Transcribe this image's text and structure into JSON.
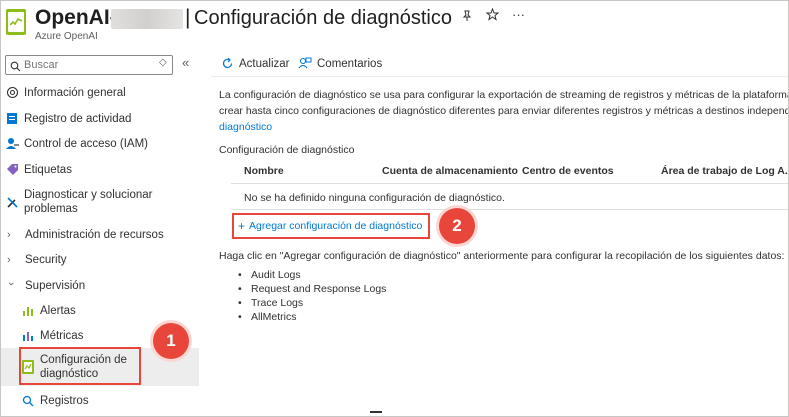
{
  "header": {
    "resource_name": "OpenAI-",
    "separator": "|",
    "page_title": "Configuración de diagnóstico",
    "subtitle": "Azure OpenAI",
    "pin_icon": "pin-icon",
    "favorite_icon": "star-icon",
    "more_label": "···"
  },
  "sidebar": {
    "search_placeholder": "Buscar",
    "search_options_label": "◇",
    "collapse_label": "«",
    "items": [
      {
        "label": "Información general",
        "icon": "openai-icon"
      },
      {
        "label": "Registro de actividad",
        "icon": "activity-log-icon"
      },
      {
        "label": "Control de acceso (IAM)",
        "icon": "access-control-icon"
      },
      {
        "label": "Etiquetas",
        "icon": "tag-icon"
      },
      {
        "label": "Diagnosticar y solucionar problemas",
        "icon": "wrench-icon"
      },
      {
        "label": "Administración de recursos",
        "icon": "chevron-right-icon"
      },
      {
        "label": "Security",
        "icon": "chevron-right-icon"
      },
      {
        "label": "Supervisión",
        "icon": "chevron-down-icon"
      },
      {
        "label": "Alertas",
        "icon": "alerts-icon"
      },
      {
        "label": "Métricas",
        "icon": "metrics-icon"
      },
      {
        "label": "Configuración de diagnóstico",
        "icon": "diagnostic-settings-icon"
      },
      {
        "label": "Registros",
        "icon": "logs-icon"
      }
    ]
  },
  "toolbar": {
    "refresh_label": "Actualizar",
    "feedback_label": "Comentarios"
  },
  "content": {
    "description_line1": "La configuración de diagnóstico se usa para configurar la exportación de streaming de registros y métricas de la plataforma d",
    "description_line2": "crear hasta cinco configuraciones de diagnóstico diferentes para enviar diferentes registros y métricas a destinos independier",
    "description_link": "diagnóstico",
    "section_label": "Configuración de diagnóstico",
    "columns": [
      "Nombre",
      "Cuenta de almacenamiento",
      "Centro de eventos",
      "Área de trabajo de Log A..."
    ],
    "empty_message": "No se ha definido ninguna configuración de diagnóstico.",
    "add_label": "Agregar configuración de diagnóstico",
    "add_plus": "+",
    "info_text": "Haga clic en \"Agregar configuración de diagnóstico\" anteriormente para configurar la recopilación de los siguientes datos:",
    "data_items": [
      "Audit Logs",
      "Request and Response Logs",
      "Trace Logs",
      "AllMetrics"
    ]
  },
  "callouts": {
    "step1": "1",
    "step2": "2",
    "color": "#e8463a"
  }
}
